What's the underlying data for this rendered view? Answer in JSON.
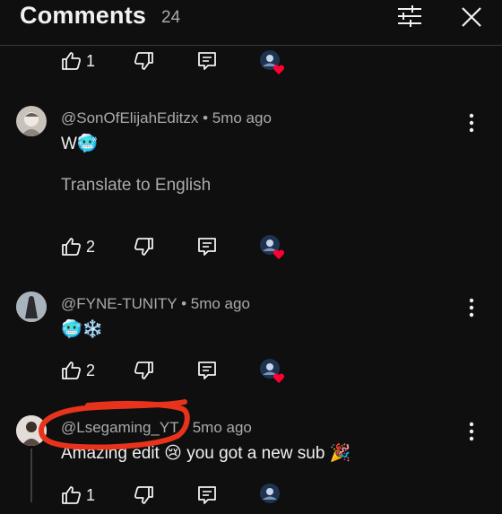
{
  "header": {
    "title": "Comments",
    "count": "24"
  },
  "icons": {
    "filter": "filter-sliders-icon",
    "close": "close-icon",
    "like": "thumbs-up-icon",
    "dislike": "thumbs-down-icon",
    "reply": "reply-comment-icon",
    "more": "more-vertical-icon",
    "heart": "creator-heart-icon"
  },
  "colors": {
    "background": "#0f0f0f",
    "heart": "#ff0033",
    "annotation": "#e8331c"
  },
  "top_actions": {
    "likes": "1"
  },
  "comments": [
    {
      "author": "@SonOfElijahEditzx",
      "time": "• 5mo ago",
      "text": "W🥶",
      "translate": "Translate to English",
      "likes": "2"
    },
    {
      "author": "@FYNE-TUNITY",
      "time": "• 5mo ago",
      "text": "🥶❄️",
      "likes": "2"
    },
    {
      "author": "@Lsegaming_YT",
      "time": "• 5mo ago",
      "text": "Amazing edit 😢 you got a new sub 🎉",
      "likes": "1"
    }
  ]
}
